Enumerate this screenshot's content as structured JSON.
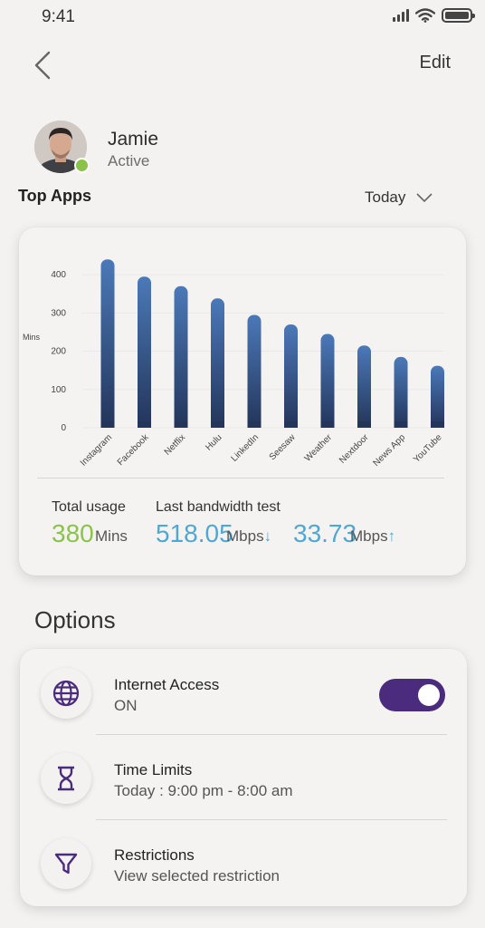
{
  "status_bar": {
    "time": "9:41"
  },
  "nav": {
    "edit_label": "Edit"
  },
  "profile": {
    "name": "Jamie",
    "status": "Active"
  },
  "top_apps": {
    "title": "Top Apps",
    "period": "Today"
  },
  "chart_data": {
    "type": "bar",
    "categories": [
      "Instagram",
      "Facebook",
      "Netflix",
      "Hulu",
      "LinkedIn",
      "Seesaw",
      "Weather",
      "Nextdoor",
      "News App",
      "YouTube"
    ],
    "values": [
      440,
      395,
      370,
      338,
      295,
      270,
      245,
      215,
      185,
      162
    ],
    "ylabel": "Mins",
    "yticks": [
      0,
      100,
      200,
      300,
      400
    ],
    "ylim": [
      0,
      450
    ],
    "bar_color_top": "#4b79b8",
    "bar_color_bottom": "#23355a"
  },
  "usage": {
    "total_label": "Total usage",
    "total_value": "380",
    "total_unit": "Mins",
    "bandwidth_label": "Last bandwidth test",
    "download_value": "518.05",
    "download_unit": "Mbps",
    "download_arrow": "↓",
    "upload_value": "33.73",
    "upload_unit": "Mbps",
    "upload_arrow": "↑"
  },
  "options": {
    "title": "Options",
    "items": [
      {
        "title": "Internet Access",
        "subtitle": "ON",
        "icon": "globe-icon"
      },
      {
        "title": "Time Limits",
        "subtitle": "Today : 9:00 pm - 8:00 am",
        "icon": "hourglass-icon"
      },
      {
        "title": "Restrictions",
        "subtitle": "View selected restriction",
        "icon": "filter-icon"
      }
    ],
    "toggle_on": true
  },
  "colors": {
    "accent_purple": "#4a2b7d",
    "usage_green": "#8bc34a",
    "bandwidth_blue": "#4fa8d2",
    "online_green": "#8bc34a"
  }
}
